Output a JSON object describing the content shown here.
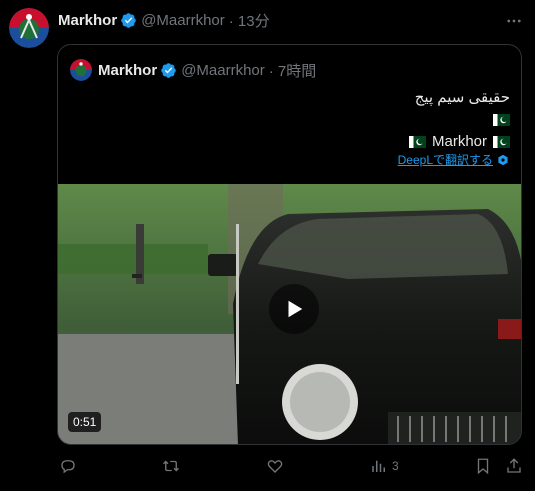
{
  "tweet": {
    "author_name": "Markhor",
    "handle": "@Maarrkhor",
    "time": "· 13分"
  },
  "quoted": {
    "author_name": "Markhor",
    "handle": "@Maarrkhor",
    "time": "· 7時間",
    "line1": "حقیقی سیم پیج",
    "line3_name": "Markhor",
    "translate_label": "DeepLで翻訳する",
    "video_duration": "0:51"
  },
  "actions": {
    "views_count": "3"
  },
  "colors": {
    "accent": "#1d9bf0",
    "muted": "#71767b",
    "border": "#2f3336"
  },
  "icons": [
    "verified-badge-icon",
    "more-icon",
    "flag-pakistan-icon",
    "translate-icon",
    "play-icon",
    "reply-icon",
    "repost-icon",
    "like-icon",
    "views-icon",
    "bookmark-icon",
    "share-icon"
  ]
}
